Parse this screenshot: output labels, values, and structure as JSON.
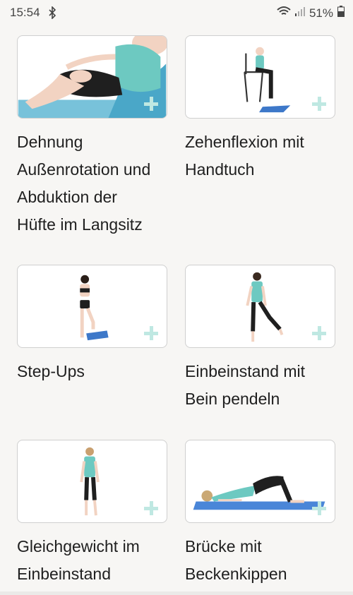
{
  "status": {
    "time": "15:54",
    "battery": "51%"
  },
  "exercises": [
    {
      "title": "Dehnung Außenrotation und Abduktion der Hüfte im Langsitz",
      "lines": [
        "Dehnung",
        "Außenrotation und",
        "Abduktion der",
        "Hüfte im Langsitz"
      ]
    },
    {
      "title": "Zehenflexion mit Handtuch",
      "lines": [
        "Zehenflexion mit",
        "Handtuch"
      ]
    },
    {
      "title": "Step-Ups",
      "lines": [
        "Step-Ups"
      ]
    },
    {
      "title": "Einbeinstand mit Bein pendeln",
      "lines": [
        "Einbeinstand mit",
        "Bein pendeln"
      ]
    },
    {
      "title": "Gleichgewicht im Einbeinstand",
      "lines": [
        "Gleichgewicht im",
        "Einbeinstand"
      ]
    },
    {
      "title": "Brücke mit Beckenkippen",
      "lines": [
        "Brücke mit",
        "Beckenkippen"
      ]
    }
  ],
  "colors": {
    "accent": "#bfe8e2",
    "mat": "#5b8fd6",
    "shirt": "#6dc9c1"
  }
}
